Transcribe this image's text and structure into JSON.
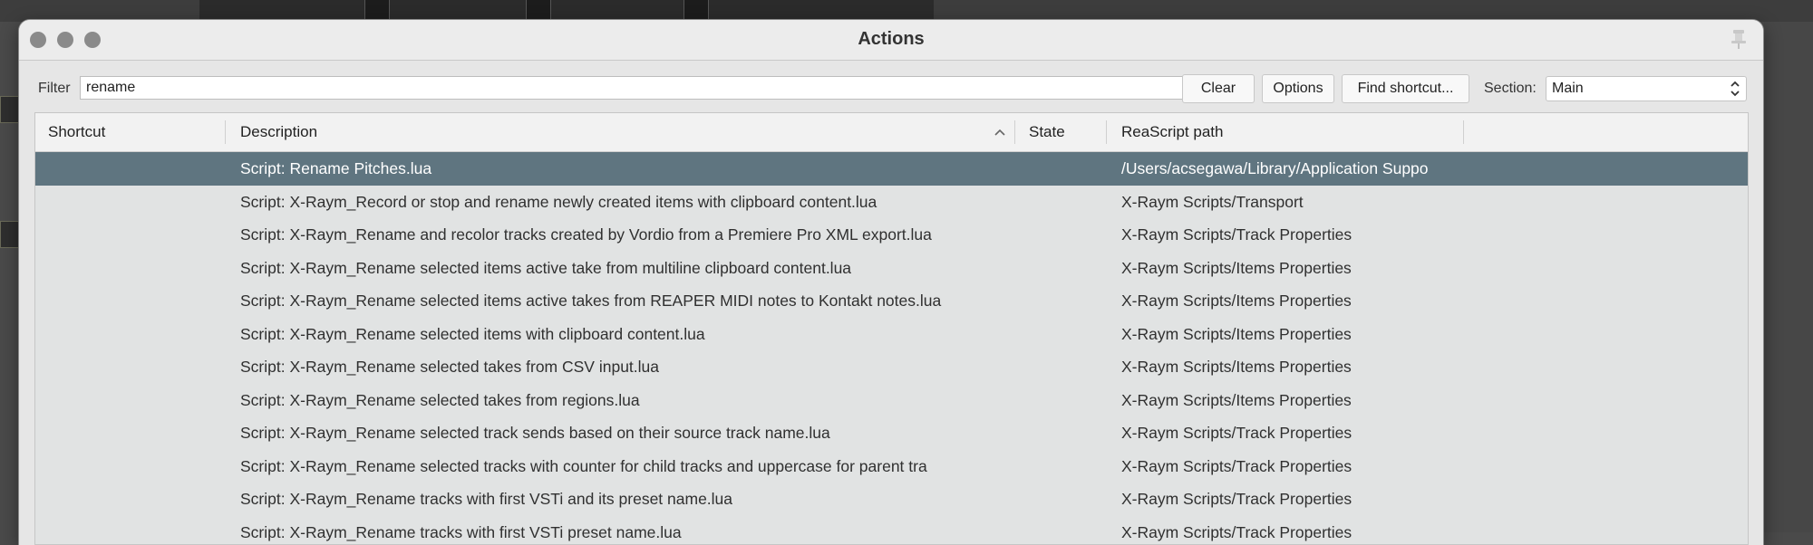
{
  "window": {
    "title": "Actions"
  },
  "filter": {
    "label": "Filter",
    "value": "rename"
  },
  "buttons": {
    "clear": "Clear",
    "options": "Options",
    "find_shortcut": "Find shortcut..."
  },
  "section": {
    "label": "Section:",
    "value": "Main"
  },
  "table": {
    "columns": {
      "shortcut": "Shortcut",
      "description": "Description",
      "state": "State",
      "path": "ReaScript path"
    },
    "sort_column": "Description",
    "sort_direction": "ascending",
    "selected_row": 0,
    "rows": [
      {
        "shortcut": "",
        "description": "Script: Rename Pitches.lua",
        "state": "",
        "path": "/Users/acsegawa/Library/Application Suppo"
      },
      {
        "shortcut": "",
        "description": "Script: X-Raym_Record or stop and rename newly created items with clipboard content.lua",
        "state": "",
        "path": "X-Raym Scripts/Transport"
      },
      {
        "shortcut": "",
        "description": "Script: X-Raym_Rename and recolor tracks created by Vordio from a Premiere Pro XML export.lua",
        "state": "",
        "path": "X-Raym Scripts/Track Properties"
      },
      {
        "shortcut": "",
        "description": "Script: X-Raym_Rename selected items active take from multiline clipboard content.lua",
        "state": "",
        "path": "X-Raym Scripts/Items Properties"
      },
      {
        "shortcut": "",
        "description": "Script: X-Raym_Rename selected items active takes from REAPER MIDI notes to Kontakt notes.lua",
        "state": "",
        "path": "X-Raym Scripts/Items Properties"
      },
      {
        "shortcut": "",
        "description": "Script: X-Raym_Rename selected items with clipboard content.lua",
        "state": "",
        "path": "X-Raym Scripts/Items Properties"
      },
      {
        "shortcut": "",
        "description": "Script: X-Raym_Rename selected takes from CSV input.lua",
        "state": "",
        "path": "X-Raym Scripts/Items Properties"
      },
      {
        "shortcut": "",
        "description": "Script: X-Raym_Rename selected takes from regions.lua",
        "state": "",
        "path": "X-Raym Scripts/Items Properties"
      },
      {
        "shortcut": "",
        "description": "Script: X-Raym_Rename selected track sends based on their source track name.lua",
        "state": "",
        "path": "X-Raym Scripts/Track Properties"
      },
      {
        "shortcut": "",
        "description": "Script: X-Raym_Rename selected tracks with counter for child tracks and uppercase for parent tra",
        "state": "",
        "path": "X-Raym Scripts/Track Properties"
      },
      {
        "shortcut": "",
        "description": "Script: X-Raym_Rename tracks with first VSTi and its preset name.lua",
        "state": "",
        "path": "X-Raym Scripts/Track Properties"
      },
      {
        "shortcut": "",
        "description": "Script: X-Raym_Rename tracks with first VSTi preset name.lua",
        "state": "",
        "path": "X-Raym Scripts/Track Properties"
      }
    ]
  },
  "icons": {
    "close": "traffic-light-close-icon",
    "minimize": "traffic-light-minimize-icon",
    "zoom": "traffic-light-zoom-icon",
    "pin": "pin-icon",
    "sort": "sort-ascending-icon",
    "select": "updown-chevron-icon"
  },
  "colors": {
    "selected_row": "#5f7580",
    "row_bg": "#e1e3e3",
    "traffic_light": "#8a8a8a"
  }
}
